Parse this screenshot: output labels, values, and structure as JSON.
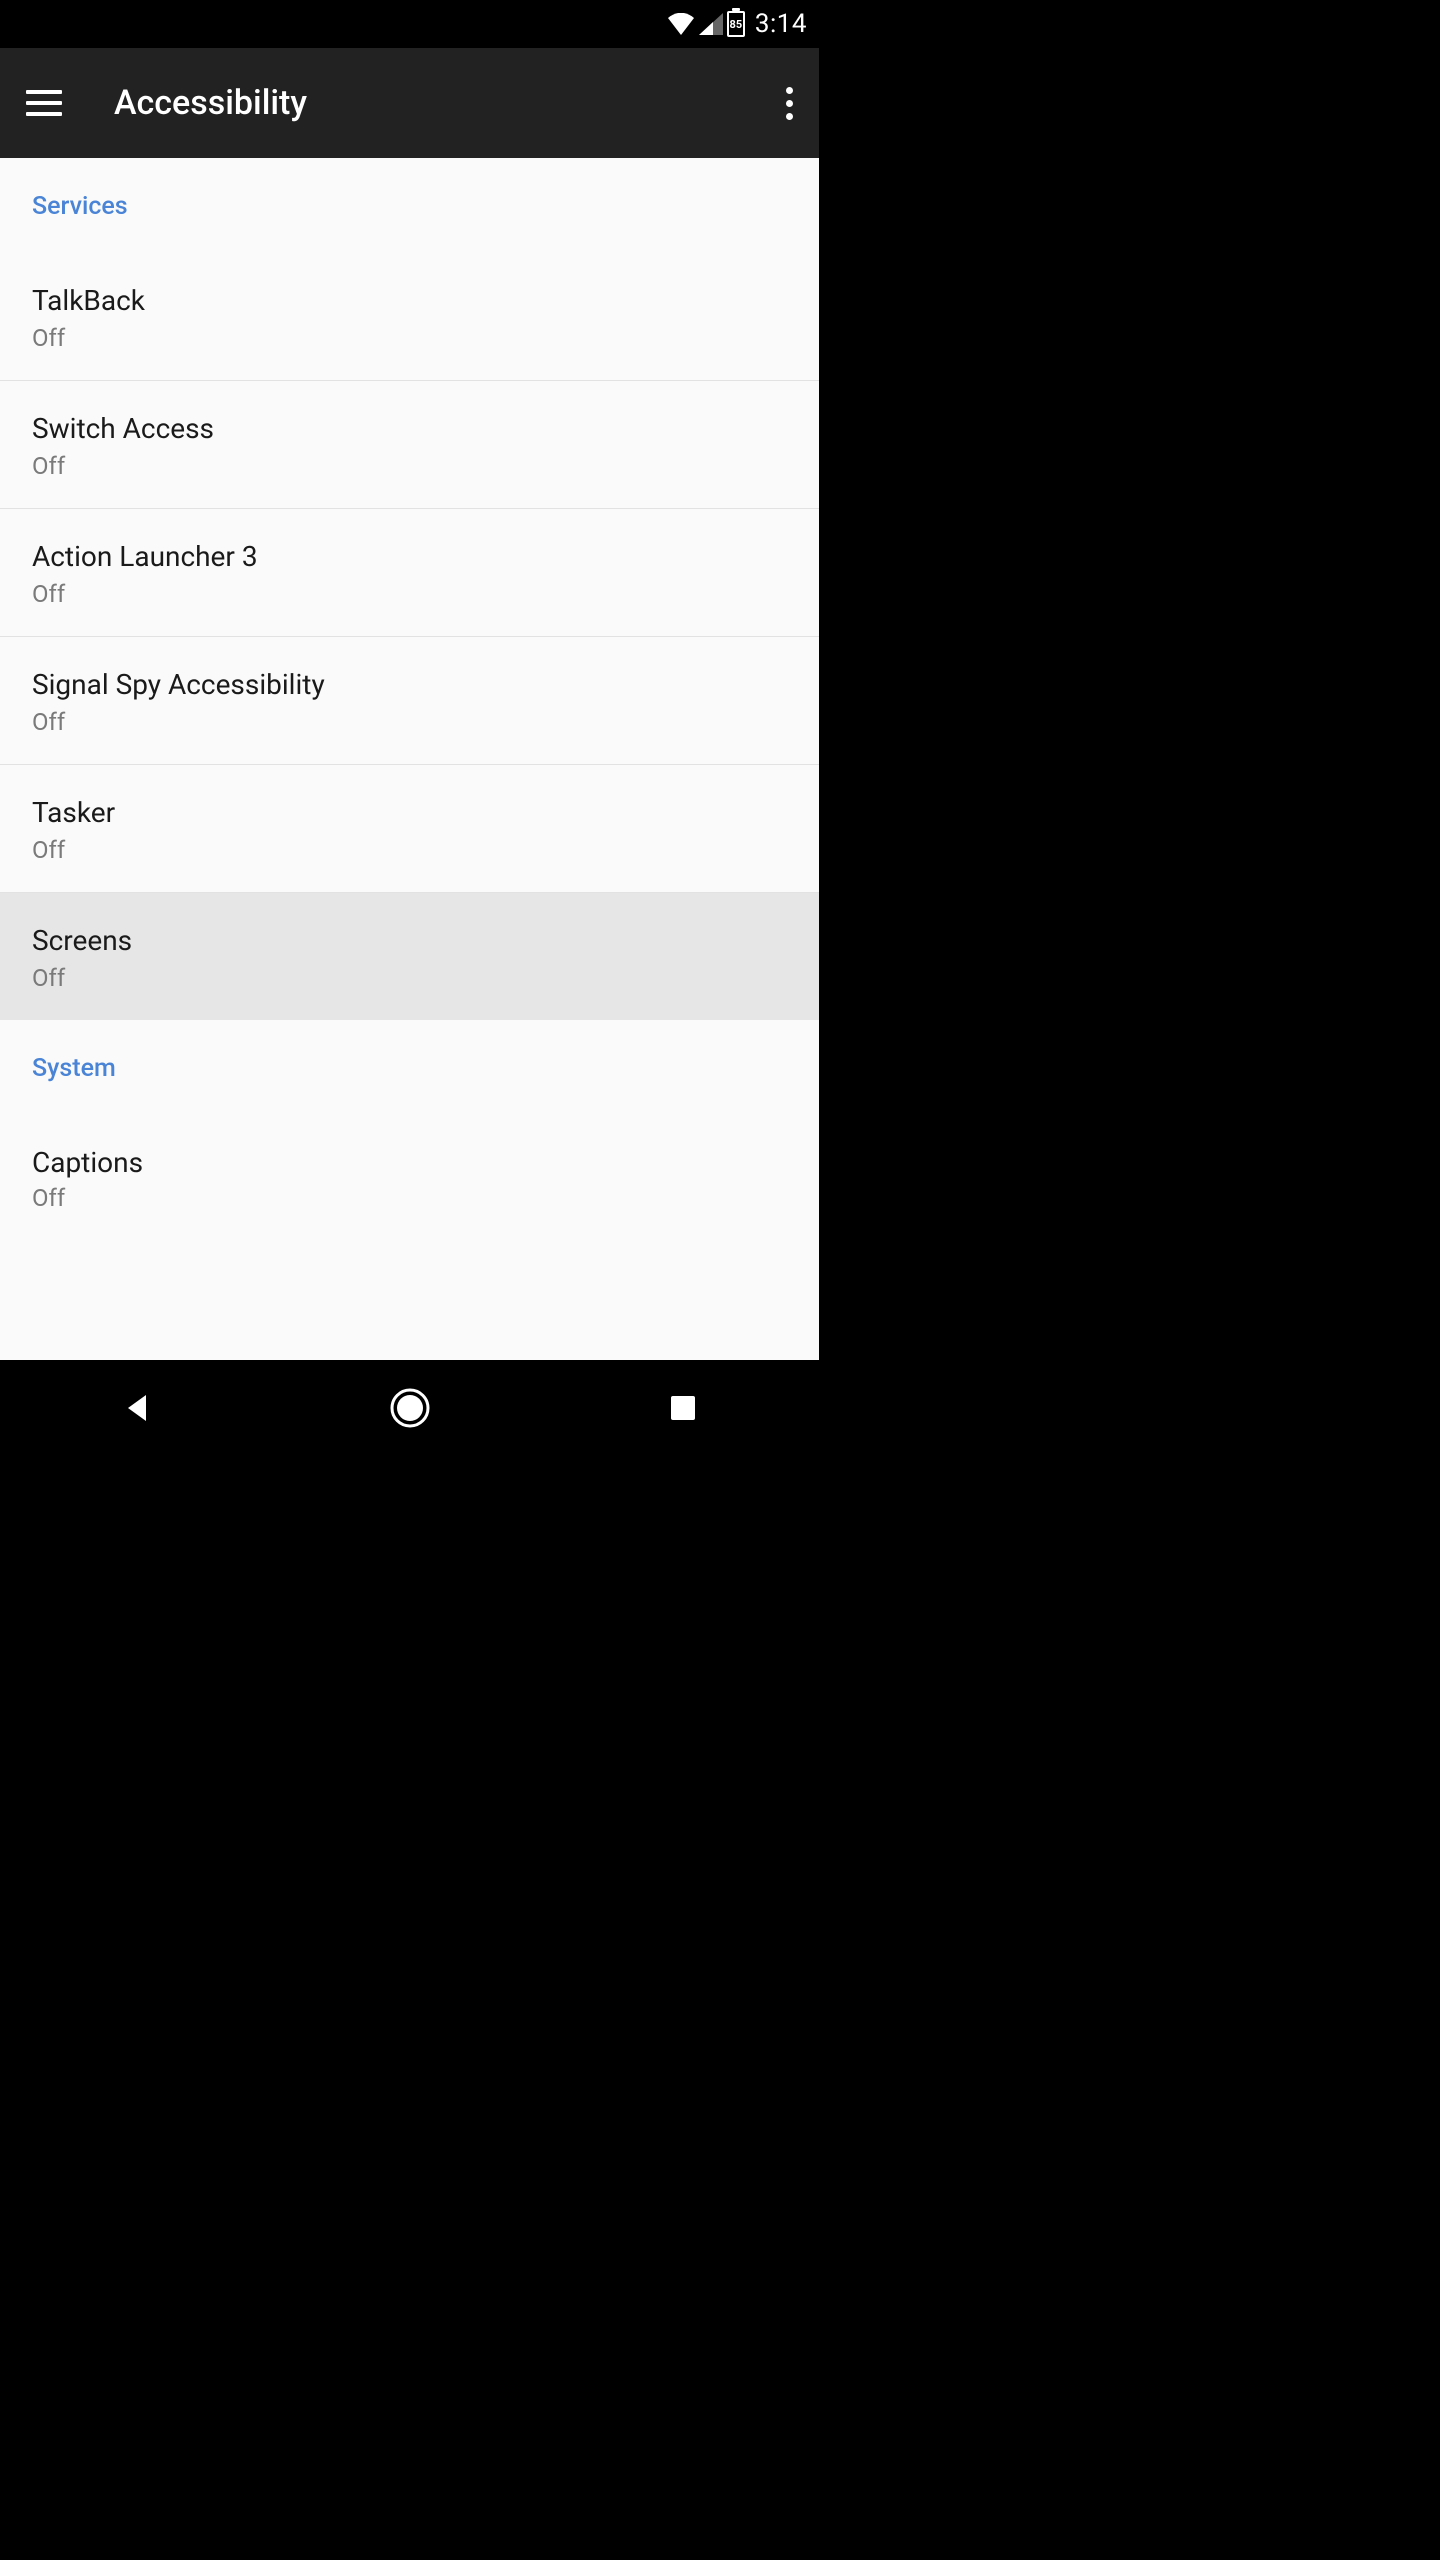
{
  "status": {
    "battery_pct": "85",
    "time": "3:14"
  },
  "appbar": {
    "title": "Accessibility"
  },
  "sections": {
    "services": {
      "header": "Services",
      "items": [
        {
          "title": "TalkBack",
          "subtitle": "Off"
        },
        {
          "title": "Switch Access",
          "subtitle": "Off"
        },
        {
          "title": "Action Launcher 3",
          "subtitle": "Off"
        },
        {
          "title": "Signal Spy Accessibility",
          "subtitle": "Off"
        },
        {
          "title": "Tasker",
          "subtitle": "Off"
        },
        {
          "title": "Screens",
          "subtitle": "Off"
        }
      ]
    },
    "system": {
      "header": "System",
      "items": [
        {
          "title": "Captions",
          "subtitle": "Off"
        }
      ]
    }
  }
}
